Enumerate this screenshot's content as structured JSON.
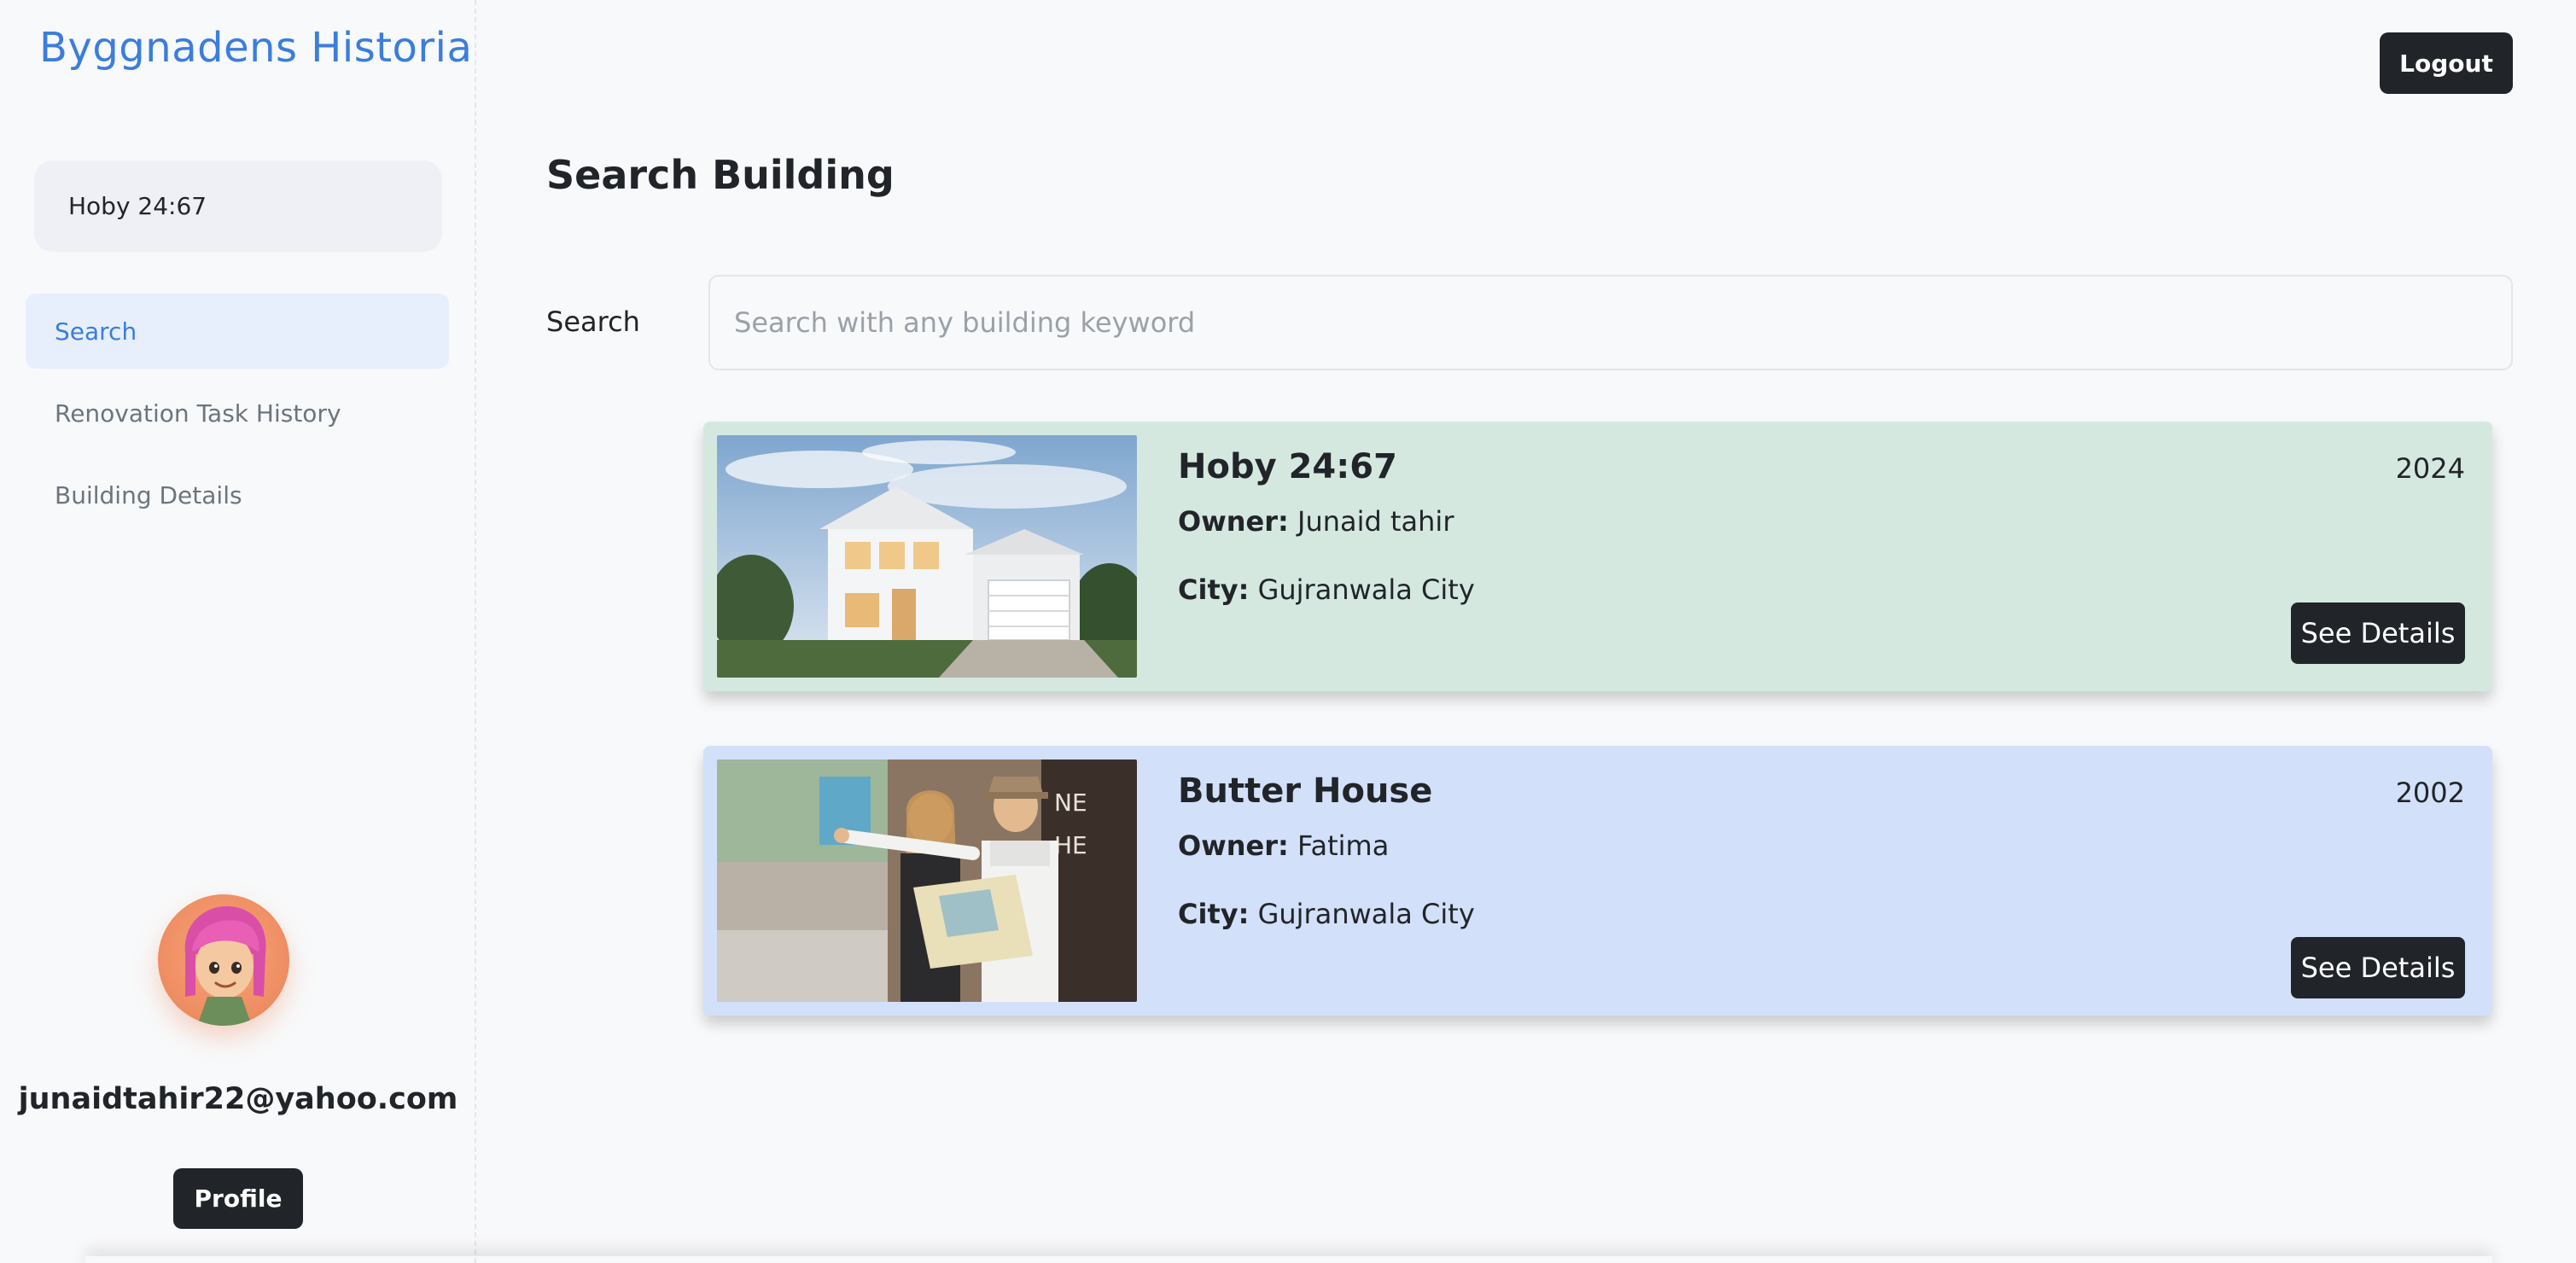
{
  "app": {
    "brand": "Byggnadens Historia"
  },
  "sidebar": {
    "current_building": "Hoby 24:67",
    "nav": [
      {
        "label": "Search",
        "active": true
      },
      {
        "label": "Renovation Task History",
        "active": false
      },
      {
        "label": "Building Details",
        "active": false
      }
    ],
    "user_email": "junaidtahir22@yahoo.com",
    "profile_label": "Profile"
  },
  "header": {
    "logout_label": "Logout"
  },
  "main": {
    "title": "Search Building",
    "search": {
      "label": "Search",
      "placeholder": "Search with any building keyword",
      "value": ""
    },
    "results": [
      {
        "name": "Hoby 24:67",
        "year": "2024",
        "owner_label": "Owner:",
        "owner": "Junaid tahir",
        "city_label": "City:",
        "city": "Gujranwala City",
        "button_label": "See Details",
        "background": "#d5e8e0",
        "image": "white-two-story-house-photo"
      },
      {
        "name": "Butter House",
        "year": "2002",
        "owner_label": "Owner:",
        "owner": "Fatima",
        "city_label": "City:",
        "city": "Gujranwala City",
        "button_label": "See Details",
        "background": "#d3e0fa",
        "image": "tourist-couple-with-map-photo"
      }
    ]
  },
  "colors": {
    "accent": "#3b7ddd",
    "dark_button": "#212529",
    "active_nav_bg": "#e7effc"
  }
}
